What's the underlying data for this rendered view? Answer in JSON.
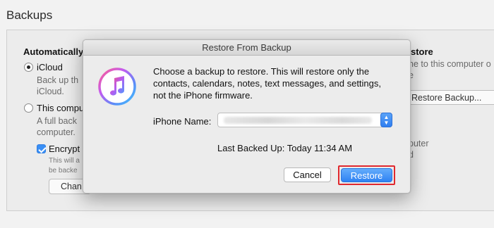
{
  "page": {
    "title": "Backups"
  },
  "background": {
    "left_heading": "Automatically",
    "icloud_label": "iCloud",
    "icloud_desc_1": "Back up th",
    "icloud_desc_2": "iCloud.",
    "computer_label": "This compu",
    "computer_desc_1": "A full back",
    "computer_desc_2": "computer.",
    "encrypt_label": "Encrypt",
    "encrypt_desc_1": "This will a",
    "encrypt_desc_2": "be backe",
    "change_button": "Chan",
    "right_heading": "store",
    "right_desc_1": "ne to this computer o",
    "right_desc_2": "e",
    "restore_backup_button": "Restore Backup...",
    "right_puter": "puter",
    "right_d": "d"
  },
  "dialog": {
    "title": "Restore From Backup",
    "message": "Choose a backup to restore. This will restore only the contacts, calendars, notes, text messages, and settings, not the iPhone firmware.",
    "iphone_name_label": "iPhone Name:",
    "iphone_name_value": "",
    "last_backed_up": "Last Backed Up: Today 11:34 AM",
    "cancel_label": "Cancel",
    "restore_label": "Restore",
    "app_icon": "itunes-icon"
  },
  "colors": {
    "accent": "#3a8ff5",
    "highlight": "#e0282e"
  }
}
